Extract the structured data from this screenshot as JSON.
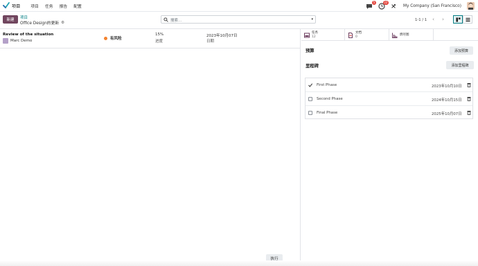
{
  "navbar": {
    "app_name": "项目",
    "menu": [
      "项目",
      "任务",
      "报告",
      "配置"
    ],
    "chat_badge": "5",
    "activity_badge": "22",
    "company": "My Company (San Francisco)"
  },
  "control": {
    "new_label": "新建",
    "breadcrumb_parent": "项目",
    "breadcrumb_current": "Office Design的更新",
    "search_placeholder": "搜索...",
    "pager": "1-1 / 1"
  },
  "update": {
    "name": "Review of the situation",
    "assignee": "Marc Demo",
    "status": "有风险",
    "status_color": "#f3832f",
    "progress_value": "15%",
    "progress_label": "进度",
    "date_value": "2023年10月07日",
    "date_label": "日期"
  },
  "list_footer": {
    "exec_label": "执行"
  },
  "right_panel": {
    "tabs": [
      {
        "label": "任务",
        "count": "12"
      },
      {
        "label": "文档",
        "count": "0"
      },
      {
        "label": "燃尽图",
        "count": ""
      }
    ],
    "budget_title": "预算",
    "budget_button": "添加预算",
    "milestones_title": "里程碑",
    "milestones_button": "添加里程碑",
    "milestones": [
      {
        "name": "First Phase",
        "date": "2023年10月10日",
        "done": true
      },
      {
        "name": "Second Phase",
        "date": "2024年10月15日",
        "done": false
      },
      {
        "name": "Final Phase",
        "date": "2025年10月07日",
        "done": false
      }
    ]
  },
  "colors": {
    "primary": "#71465f",
    "accent": "#017e84",
    "badge": "#e4453c"
  }
}
